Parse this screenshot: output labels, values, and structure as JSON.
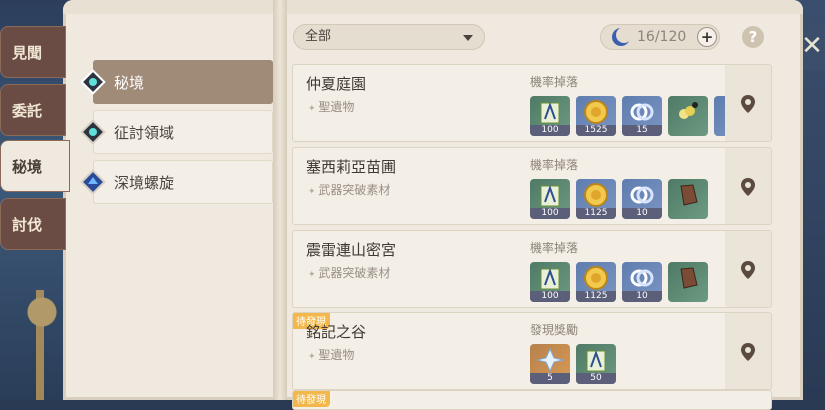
{
  "side_tabs": [
    "見聞",
    "委託",
    "秘境",
    "討伐"
  ],
  "categories": [
    "秘境",
    "征討領域",
    "深境螺旋"
  ],
  "filter": {
    "label": "全部"
  },
  "resin": {
    "count": "16/120",
    "plus": "+"
  },
  "help": "?",
  "close": "✕",
  "domains": [
    {
      "name": "仲夏庭園",
      "type": "聖遺物",
      "reward_label": "機率掉落",
      "items": [
        {
          "qty": "100",
          "kind": "exp-book"
        },
        {
          "qty": "1525",
          "kind": "mora"
        },
        {
          "qty": "15",
          "kind": "adventure-exp"
        },
        {
          "qty": "",
          "kind": "artifact-flower"
        },
        {
          "qty": "",
          "kind": "artifact-partial"
        }
      ]
    },
    {
      "name": "塞西莉亞苗圃",
      "type": "武器突破素材",
      "reward_label": "機率掉落",
      "items": [
        {
          "qty": "100",
          "kind": "exp-book"
        },
        {
          "qty": "1125",
          "kind": "mora"
        },
        {
          "qty": "10",
          "kind": "adventure-exp"
        },
        {
          "qty": "",
          "kind": "weapon-material"
        }
      ]
    },
    {
      "name": "震雷連山密宮",
      "type": "武器突破素材",
      "reward_label": "機率掉落",
      "items": [
        {
          "qty": "100",
          "kind": "exp-book"
        },
        {
          "qty": "1125",
          "kind": "mora"
        },
        {
          "qty": "10",
          "kind": "adventure-exp"
        },
        {
          "qty": "",
          "kind": "weapon-material"
        }
      ]
    },
    {
      "name": "銘記之谷",
      "type": "聖遺物",
      "reward_label": "發現獎勵",
      "badge": "待發現",
      "items": [
        {
          "qty": "5",
          "kind": "primogem"
        },
        {
          "qty": "50",
          "kind": "exp-book"
        }
      ]
    }
  ],
  "partial_badge": "待發現",
  "colors": {
    "accent": "#a08a78",
    "side_tab": "#6b4c44",
    "pending": "#f2b84b"
  }
}
